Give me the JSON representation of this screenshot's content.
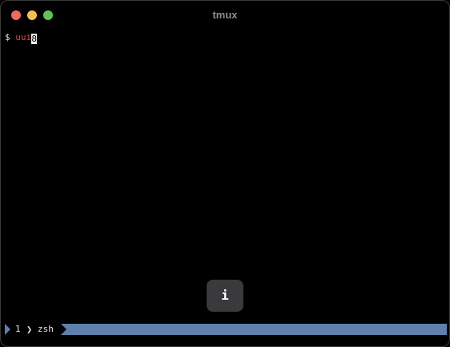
{
  "window": {
    "title": "tmux"
  },
  "terminal": {
    "prompt": "$ ",
    "typed_text": "uui",
    "cursor_char": "8"
  },
  "hud": {
    "label": "i"
  },
  "statusbar": {
    "window_index": "1",
    "separator": "❯",
    "window_name": "zsh",
    "accent_color": "#5e81ac"
  },
  "colors": {
    "background": "#000000",
    "close": "#ed6a5e",
    "minimize": "#f5bf4f",
    "zoom": "#61c554",
    "typed_text": "#e0404a"
  }
}
